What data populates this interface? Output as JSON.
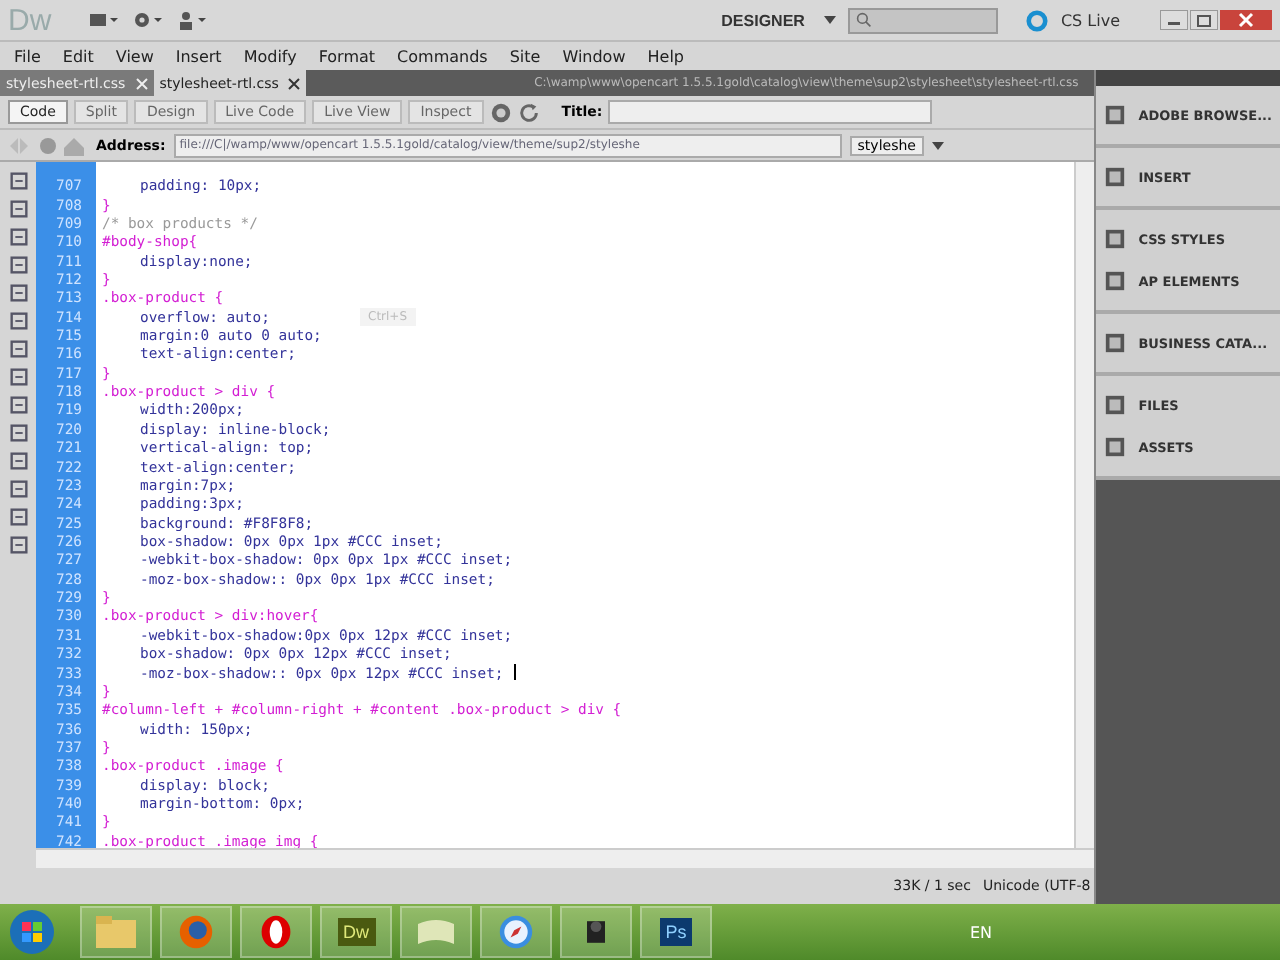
{
  "app": {
    "logo": "Dw",
    "workspace": "DESIGNER",
    "cs_live": "CS Live"
  },
  "menu": [
    "File",
    "Edit",
    "View",
    "Insert",
    "Modify",
    "Format",
    "Commands",
    "Site",
    "Window",
    "Help"
  ],
  "doc_tabs": [
    {
      "label": "stylesheet-rtl.css",
      "selected": false
    },
    {
      "label": "stylesheet-rtl.css",
      "selected": true
    }
  ],
  "doc_path": "C:\\wamp\\www\\opencart 1.5.5.1gold\\catalog\\view\\theme\\sup2\\stylesheet\\stylesheet-rtl.css",
  "view_buttons": [
    {
      "label": "Code",
      "disabled": false
    },
    {
      "label": "Split",
      "disabled": true
    },
    {
      "label": "Design",
      "disabled": true
    },
    {
      "label": "Live Code",
      "disabled": true
    },
    {
      "label": "Live View",
      "disabled": true
    },
    {
      "label": "Inspect",
      "disabled": true
    }
  ],
  "title_label": "Title:",
  "address": {
    "label": "Address:",
    "value": "file:///C|/wamp/www/opencart 1.5.5.1gold/catalog/view/theme/sup2/styleshe",
    "file": "styleshe"
  },
  "tooltip": "Ctrl+S",
  "code_lines": [
    {
      "num": "707",
      "kind": "prop",
      "text": "padding: 10px;"
    },
    {
      "num": "708",
      "kind": "brace",
      "text": "}"
    },
    {
      "num": "709",
      "kind": "comment",
      "text": "/* box products */"
    },
    {
      "num": "710",
      "kind": "selector",
      "text": "#body-shop{"
    },
    {
      "num": "711",
      "kind": "prop",
      "text": "display:none;"
    },
    {
      "num": "712",
      "kind": "brace",
      "text": "}"
    },
    {
      "num": "713",
      "kind": "selector",
      "text": ".box-product {"
    },
    {
      "num": "714",
      "kind": "prop",
      "text": "overflow: auto;"
    },
    {
      "num": "715",
      "kind": "prop",
      "text": "margin:0 auto 0 auto;"
    },
    {
      "num": "716",
      "kind": "prop",
      "text": "text-align:center;"
    },
    {
      "num": "717",
      "kind": "brace",
      "text": "}"
    },
    {
      "num": "718",
      "kind": "selector",
      "text": ".box-product > div {"
    },
    {
      "num": "719",
      "kind": "prop",
      "text": "width:200px;"
    },
    {
      "num": "720",
      "kind": "prop",
      "text": "display: inline-block;"
    },
    {
      "num": "721",
      "kind": "prop",
      "text": "vertical-align: top;"
    },
    {
      "num": "722",
      "kind": "prop",
      "text": "text-align:center;"
    },
    {
      "num": "723",
      "kind": "prop",
      "text": "margin:7px;"
    },
    {
      "num": "724",
      "kind": "prop",
      "text": "padding:3px;"
    },
    {
      "num": "725",
      "kind": "prop",
      "text": "background: #F8F8F8;"
    },
    {
      "num": "726",
      "kind": "prop",
      "text": "box-shadow: 0px 0px 1px #CCC inset;"
    },
    {
      "num": "727",
      "kind": "prop",
      "text": "-webkit-box-shadow: 0px 0px 1px #CCC inset;"
    },
    {
      "num": "728",
      "kind": "prop",
      "text": "-moz-box-shadow:: 0px 0px 1px #CCC inset;"
    },
    {
      "num": "729",
      "kind": "brace",
      "text": "}"
    },
    {
      "num": "730",
      "kind": "selector",
      "text": ".box-product > div:hover{"
    },
    {
      "num": "731",
      "kind": "prop",
      "text": "-webkit-box-shadow:0px 0px 12px #CCC inset;"
    },
    {
      "num": "732",
      "kind": "prop",
      "text": "box-shadow: 0px 0px 12px #CCC inset;"
    },
    {
      "num": "733",
      "kind": "prop",
      "text": "-moz-box-shadow:: 0px 0px 12px #CCC inset;",
      "caret": true
    },
    {
      "num": "734",
      "kind": "brace",
      "text": "}"
    },
    {
      "num": "735",
      "kind": "selector",
      "text": "#column-left + #column-right + #content .box-product > div {"
    },
    {
      "num": "736",
      "kind": "prop",
      "text": "width: 150px;"
    },
    {
      "num": "737",
      "kind": "brace",
      "text": "}"
    },
    {
      "num": "738",
      "kind": "selector",
      "text": ".box-product .image {"
    },
    {
      "num": "739",
      "kind": "prop",
      "text": "display: block;"
    },
    {
      "num": "740",
      "kind": "prop",
      "text": "margin-bottom: 0px;"
    },
    {
      "num": "741",
      "kind": "brace",
      "text": "}"
    },
    {
      "num": "742",
      "kind": "selector",
      "text": ".box-product .image img {"
    }
  ],
  "panel_groups": [
    [
      "ADOBE BROWSE..."
    ],
    [
      "INSERT"
    ],
    [
      "CSS STYLES",
      "AP ELEMENTS"
    ],
    [
      "BUSINESS CATA..."
    ],
    [
      "FILES",
      "ASSETS"
    ]
  ],
  "status_bar": {
    "size": "33K / 1 sec",
    "encoding": "Unicode (UTF-8"
  },
  "taskbar": {
    "apps": [
      {
        "kind": "folder"
      },
      {
        "kind": "firefox"
      },
      {
        "kind": "opera"
      },
      {
        "kind": "dw",
        "label": "Dw"
      },
      {
        "kind": "notes"
      },
      {
        "kind": "safari"
      },
      {
        "kind": "camera"
      },
      {
        "kind": "ps",
        "label": "Ps"
      }
    ],
    "language": "EN"
  }
}
